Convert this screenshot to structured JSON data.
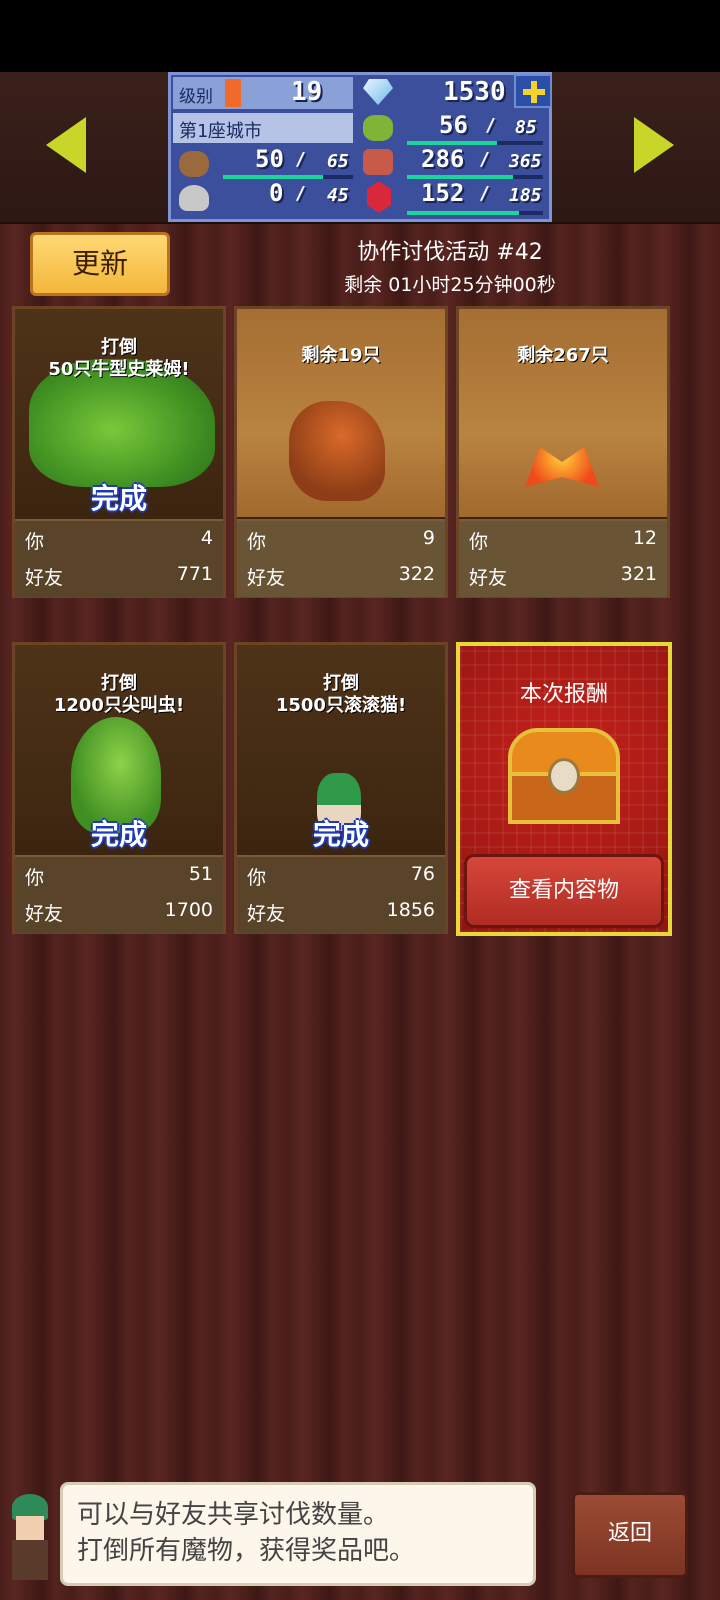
{
  "header": {
    "level_label": "级别",
    "level_value": "19",
    "gems": "1530",
    "city_name": "第1座城市",
    "grass": {
      "value": "56",
      "max": "85",
      "fill": 0.66
    },
    "wood": {
      "value": "50",
      "max": "65",
      "fill": 0.77
    },
    "food": {
      "value": "286",
      "max": "365",
      "fill": 0.78
    },
    "stone": {
      "value": "0",
      "max": "45",
      "fill": 0.0
    },
    "ruby": {
      "value": "152",
      "max": "185",
      "fill": 0.82
    }
  },
  "toolbar": {
    "refresh_label": "更新"
  },
  "event": {
    "title": "协作讨伐活动 #42",
    "timer": "剩余 01小时25分钟00秒"
  },
  "labels": {
    "you": "你",
    "friend": "好友",
    "done": "完成"
  },
  "cards": [
    {
      "title_line1": "打倒",
      "title_line2": "50只牛型史莱姆!",
      "you": "4",
      "friend": "771",
      "done": true
    },
    {
      "title_line1": "剩余19只",
      "title_line2": "",
      "you": "9",
      "friend": "322",
      "done": false
    },
    {
      "title_line1": "剩余267只",
      "title_line2": "",
      "you": "12",
      "friend": "321",
      "done": false
    },
    {
      "title_line1": "打倒",
      "title_line2": "1200只尖叫虫!",
      "you": "51",
      "friend": "1700",
      "done": true
    },
    {
      "title_line1": "打倒",
      "title_line2": "1500只滚滚猫!",
      "you": "76",
      "friend": "1856",
      "done": true
    }
  ],
  "reward": {
    "title": "本次报酬",
    "button": "查看内容物"
  },
  "dialog": {
    "line1": "可以与好友共享讨伐数量。",
    "line2": "打倒所有魔物，获得奖品吧。"
  },
  "back_label": "返回",
  "colors": {
    "accent_yellow": "#c8d62a",
    "panel_blue": "#3b4f9c",
    "progress_green": "#1bd69b"
  }
}
